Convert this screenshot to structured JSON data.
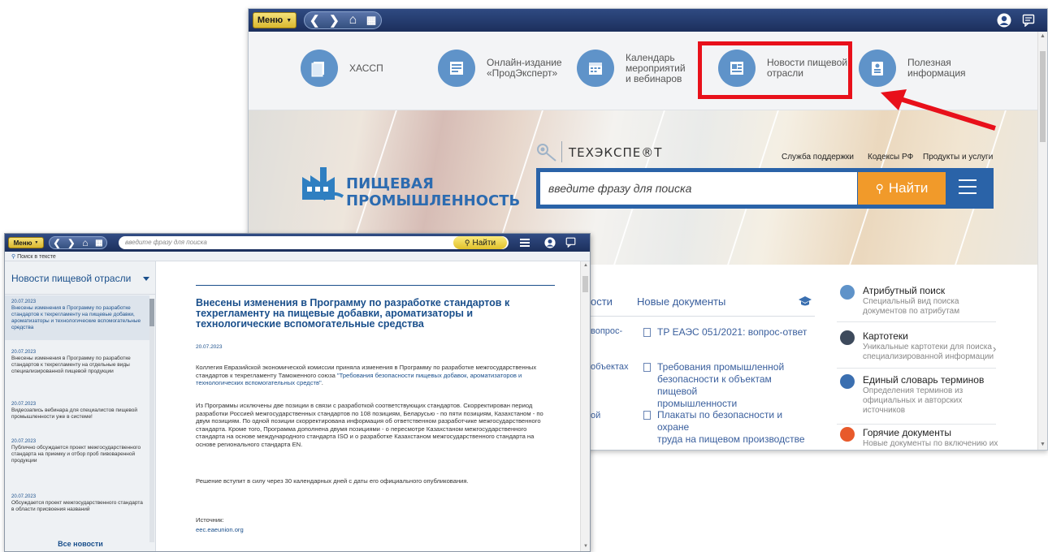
{
  "back_window": {
    "menu_label": "Меню",
    "categories": [
      {
        "label": "ХАССП",
        "icon": "folders-icon"
      },
      {
        "label": "Онлайн-издание\n«ПродЭксперт»",
        "icon": "journal-icon"
      },
      {
        "label": "Календарь\nмероприятий\nи вебинаров",
        "icon": "calendar-icon"
      },
      {
        "label": "Новости пищевой\nотрасли",
        "icon": "newspaper-icon"
      },
      {
        "label": "Полезная\nинформация",
        "icon": "info-board-icon"
      }
    ],
    "highlight_color": "#e8101a",
    "brand": "ТЕХЭКСПЕ®Т",
    "top_links": [
      "Служба поддержки",
      "Кодексы РФ",
      "Продукты и услуги"
    ],
    "logo_line1": "ПИЩЕВАЯ",
    "logo_line2": "ПРОМЫШЛЕННОСТЬ",
    "search_placeholder": "введите фразу для поиска",
    "search_button": "Найти",
    "tab_partial": "ости",
    "tab_new_docs": "Новые документы",
    "left_clipped": [
      "вопрос-",
      "объектах",
      "ой"
    ],
    "documents": [
      "ТР ЕАЭС 051/2021: вопрос-ответ",
      "Требования промышленной\nбезопасности к объектам пищевой\nпромышленности",
      "Плакаты по безопасности и охране\nтруда на пищевом производстве"
    ],
    "right_items": [
      {
        "title": "Атрибутный поиск",
        "sub": "Специальный вид поиска\nдокументов по атрибутам",
        "color": "#5f93c9"
      },
      {
        "title": "Картотеки",
        "sub": "Уникальные картотеки для поиска\nспециализированной информации",
        "color": "#3d4a5c"
      },
      {
        "title": "Единый словарь терминов",
        "sub": "Определения терминов из\nофициальных и авторских\nисточников",
        "color": "#3b6fb0"
      },
      {
        "title": "Горячие документы",
        "sub": "Новые документы по включению их",
        "color": "#e85a2b"
      }
    ]
  },
  "front_window": {
    "menu_label": "Меню",
    "search_placeholder": "введите фразу для поиска",
    "search_button": "Найти",
    "subbar_label": "Поиск в тексте",
    "sidebar_title": "Новости пищевой отрасли",
    "news": [
      {
        "date": "20.07.2023",
        "text": "Внесены изменения в Программу по разработке стандартов к техрегламенту на пищевые добавки, ароматизаторы и технологические вспомогательные средства"
      },
      {
        "date": "20.07.2023",
        "text": "Внесены изменения в Программу по разработке стандартов к техрегламенту на отдельные виды специализированной пищевой продукции"
      },
      {
        "date": "20.07.2023",
        "text": "Видеозапись вебинара для специалистов пищевой промышленности уже в системе!"
      },
      {
        "date": "20.07.2023",
        "text": "Публично обсуждается проект межгосударственного стандарта на приемку и отбор проб пивоваренной продукции"
      },
      {
        "date": "20.07.2023",
        "text": "Обсуждается проект межгосударственного стандарта в области присвоения названий"
      }
    ],
    "all_news": "Все новости",
    "article": {
      "title": "Внесены изменения в Программу по разработке стандартов к техрегламенту на пищевые добавки, ароматизаторы и технологические вспомогательные средства",
      "date": "20.07.2023",
      "p1_text": "Коллегия Евразийской экономической комиссии приняла изменения в Программу по разработке межгосударственных стандартов к техрегламенту Таможенного союза ",
      "p1_link": "\"Требования безопасности пищевых добавок, ароматизаторов и технологических вспомогательных средств\"",
      "p1_end": ".",
      "p2": "Из Программы исключены две позиции в связи с разработкой соответствующих стандартов. Скорректирован период разработки Россией межгосударственных стандартов по 108 позициям, Беларусью - по пяти позициям, Казахстаном - по двум позициям. По одной позиции скорректирована информация об ответственном разработчике межгосударственного стандарта. Кроме того, Программа дополнена двумя позициями - о пересмотре Казахстаном межгосударственного стандарта на основе международного стандарта ISO и о разработке Казахстаном межгосударственного стандарта на основе регионального стандарта EN.",
      "p3": "Решение вступит в силу через 30 календарных дней с даты его официального опубликования.",
      "source_label": "Источник:",
      "source_link": "eec.eaeunion.org"
    }
  }
}
